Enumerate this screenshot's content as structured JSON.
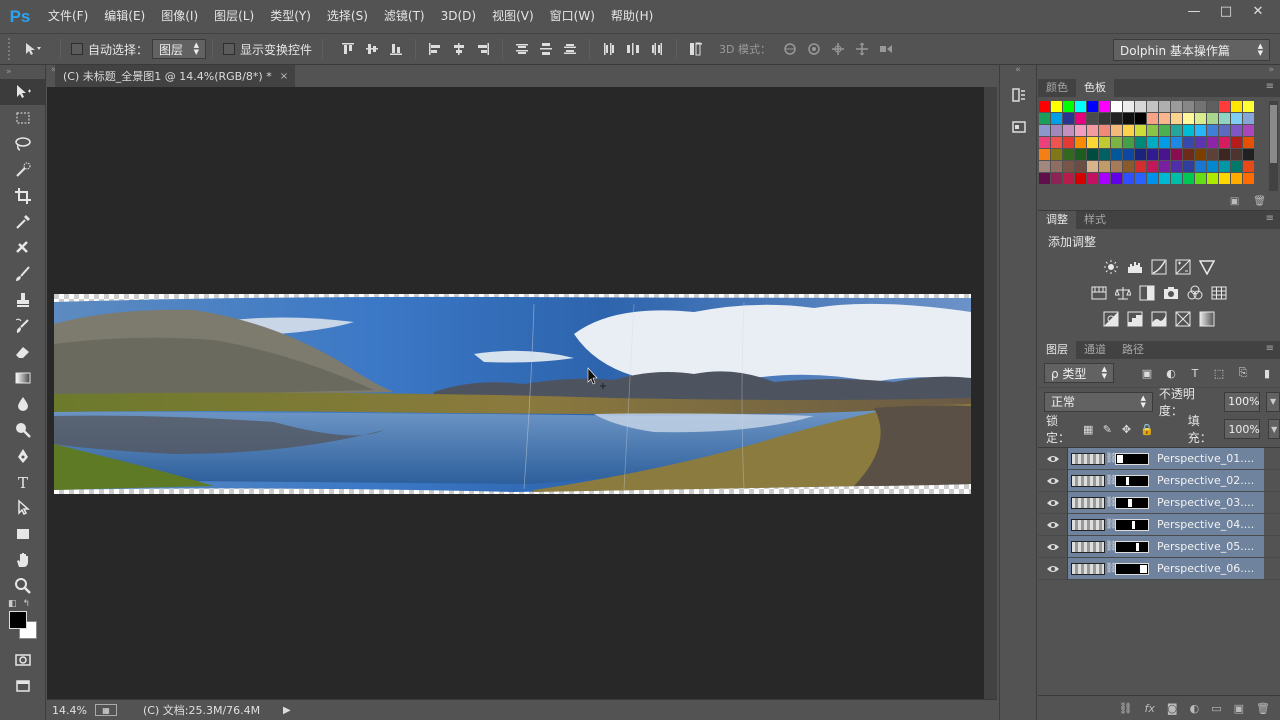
{
  "app": {
    "logo": "Ps"
  },
  "menu": [
    "文件(F)",
    "编辑(E)",
    "图像(I)",
    "图层(L)",
    "类型(Y)",
    "选择(S)",
    "滤镜(T)",
    "3D(D)",
    "视图(V)",
    "窗口(W)",
    "帮助(H)"
  ],
  "window_controls": {
    "minimize": "—",
    "maximize": "□",
    "close": "✕"
  },
  "options": {
    "auto_select_label": "自动选择：",
    "auto_select_target": "图层",
    "show_transform_label": "显示变换控件",
    "mode_3d_label": "3D 模式：",
    "workspace": "Dolphin 基本操作篇"
  },
  "document": {
    "tab_title": "(C) 未标题_全景图1 @ 14.4%(RGB/8*) *",
    "tab_close": "×"
  },
  "status": {
    "zoom": "14.4%",
    "doc_size": "(C) 文档:25.3M/76.4M",
    "arrow": "▶"
  },
  "panels": {
    "swatch_tabs": [
      "颜色",
      "色板"
    ],
    "adjust_tabs": [
      "调整",
      "样式"
    ],
    "adjust_title": "添加调整",
    "layer_tabs": [
      "图层",
      "通道",
      "路径"
    ],
    "kind_filter": "ρ 类型",
    "blend_mode": "正常",
    "opacity_label": "不透明度：",
    "opacity_value": "100%",
    "lock_label": "锁定：",
    "fill_label": "填充：",
    "fill_value": "100%"
  },
  "layers": [
    {
      "name": "Perspective_01...."
    },
    {
      "name": "Perspective_02...."
    },
    {
      "name": "Perspective_03...."
    },
    {
      "name": "Perspective_04...."
    },
    {
      "name": "Perspective_05...."
    },
    {
      "name": "Perspective_06...."
    }
  ],
  "colors": {
    "accent": "#2ba3f1",
    "layer_selected": "#6f829e",
    "canvas_bg": "#282828",
    "ui_bg": "#535353"
  }
}
